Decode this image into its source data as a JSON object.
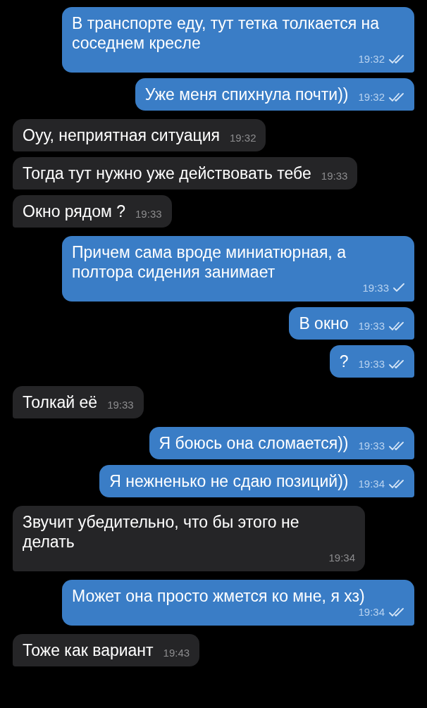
{
  "messages": [
    {
      "outgoing": true,
      "text": "В транспорте еду, тут тетка толкается на соседнем кресле",
      "time": "19:32",
      "read": true
    },
    {
      "outgoing": true,
      "text": "Уже меня спихнула почти))",
      "time": "19:32",
      "read": true
    },
    {
      "outgoing": false,
      "text": "Оуу, неприятная ситуация",
      "time": "19:32"
    },
    {
      "outgoing": false,
      "text": "Тогда тут нужно уже действовать тебе",
      "time": "19:33"
    },
    {
      "outgoing": false,
      "text": "Окно рядом ?",
      "time": "19:33"
    },
    {
      "outgoing": true,
      "text": "Причем сама вроде миниатюрная, а полтора сидения занимает",
      "time": "19:33",
      "read": false
    },
    {
      "outgoing": true,
      "text": "В окно",
      "time": "19:33",
      "read": true
    },
    {
      "outgoing": true,
      "text": "?",
      "time": "19:33",
      "read": true
    },
    {
      "outgoing": false,
      "text": "Толкай её",
      "time": "19:33"
    },
    {
      "outgoing": true,
      "text": "Я боюсь она сломается))",
      "time": "19:33",
      "read": true
    },
    {
      "outgoing": true,
      "text": "Я нежненько не сдаю позиций))",
      "time": "19:34",
      "read": true
    },
    {
      "outgoing": false,
      "text": "Звучит убедительно, что бы этого не делать",
      "time": "19:34"
    },
    {
      "outgoing": true,
      "text": "Может она просто жмется ко мне, я хз)",
      "time": "19:34",
      "read": true
    },
    {
      "outgoing": false,
      "text": "Тоже как вариант",
      "time": "19:43"
    }
  ]
}
